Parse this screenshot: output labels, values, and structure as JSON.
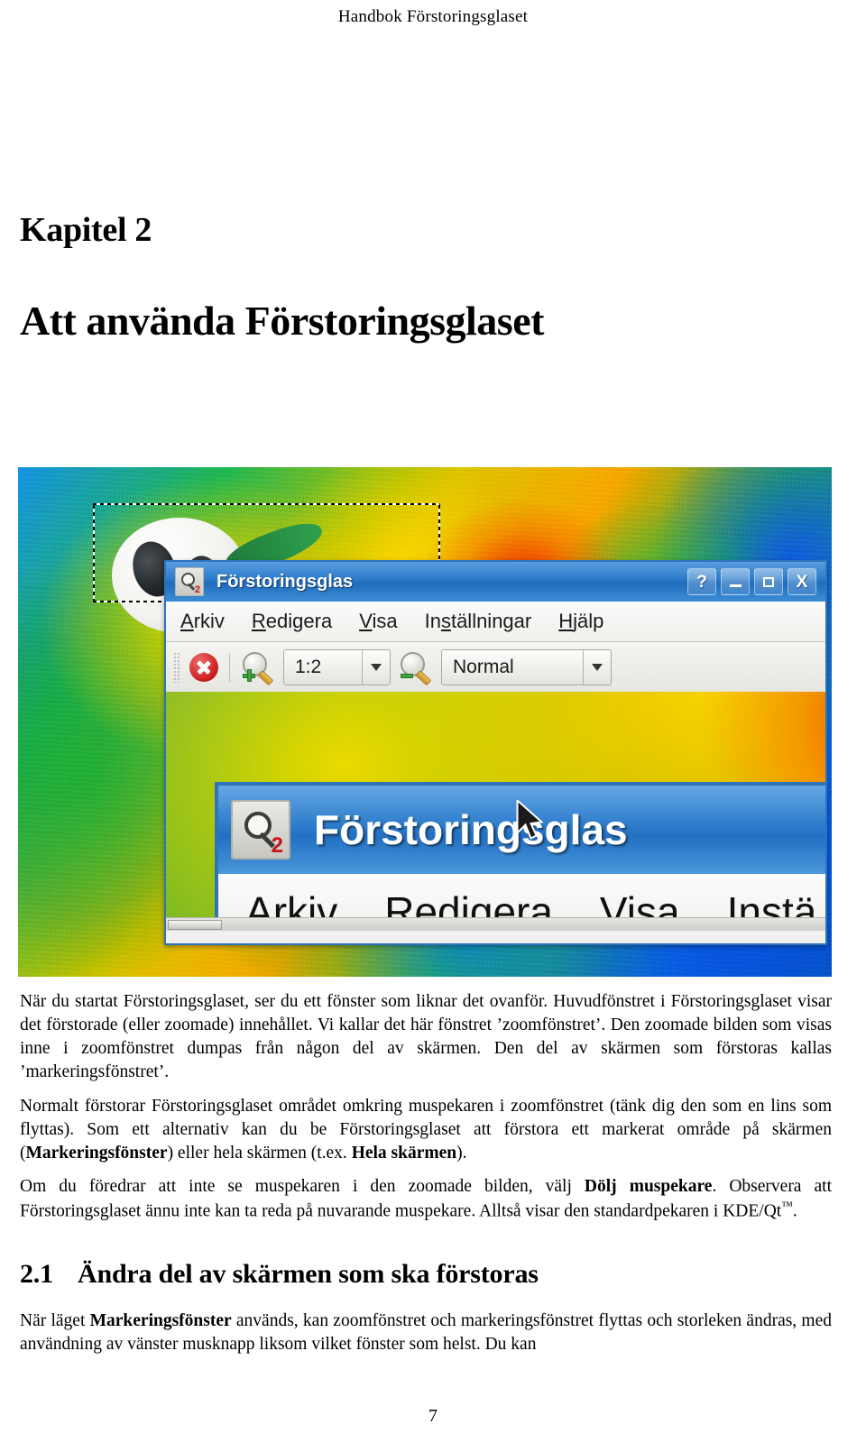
{
  "page": {
    "running_header": "Handbok Förstoringsglaset",
    "page_number": "7"
  },
  "chapter": {
    "number_label": "Kapitel 2",
    "title": "Att använda Förstoringsglaset"
  },
  "figure": {
    "caption": "",
    "window": {
      "title": "Förstoringsglas",
      "icon_name": "magnifier-2-icon",
      "buttons": {
        "help": "?",
        "minimize": "_",
        "maximize": "□",
        "close": "X"
      },
      "menu": [
        {
          "label": "Arkiv",
          "accel": "A"
        },
        {
          "label": "Redigera",
          "accel": "R"
        },
        {
          "label": "Visa",
          "accel": "V"
        },
        {
          "label": "Inställningar",
          "accel": "s"
        },
        {
          "label": "Hjälp",
          "accel": "H"
        }
      ],
      "toolbar": {
        "stop_icon": "stop-refresh-icon",
        "zoom_in_icon": "zoom-in-icon",
        "zoom_out_icon": "zoom-out-icon",
        "zoom_value": "1:2",
        "mode_value": "Normal"
      }
    },
    "zoomed_window": {
      "title": "Förstoringsglas",
      "menu": [
        "Arkiv",
        "Redigera",
        "Visa",
        "Instä"
      ],
      "cursor": "mouse-pointer"
    }
  },
  "body": {
    "paragraphs": [
      {
        "runs": [
          {
            "t": "När du startat Förstoringsglaset, ser du ett fönster som liknar det ovanför. Huvudfönstret i Förstoringsglaset visar det förstorade (eller zoomade) innehållet. Vi kallar det här fönstret ’zoomfönstret’. Den zoomade bilden som visas inne i zoomfönstret dumpas från någon del av skärmen. Den del av skärmen som förstoras kallas ’markeringsfönstret’.",
            "b": false
          }
        ]
      },
      {
        "runs": [
          {
            "t": "Normalt förstorar Förstoringsglaset området omkring muspekaren i zoomfönstret (tänk dig den som en lins som flyttas). Som ett alternativ kan du be Förstoringsglaset att förstora ett markerat område på skärmen (",
            "b": false
          },
          {
            "t": "Markeringsfönster",
            "b": true
          },
          {
            "t": ") eller hela skärmen (t.ex. ",
            "b": false
          },
          {
            "t": "Hela skärmen",
            "b": true
          },
          {
            "t": ").",
            "b": false
          }
        ]
      },
      {
        "runs": [
          {
            "t": "Om du föredrar att inte se muspekaren i den zoomade bilden, välj ",
            "b": false
          },
          {
            "t": "Dölj muspekare",
            "b": true
          },
          {
            "t": ". Observera att Förstoringsglaset ännu inte kan ta reda på nuvarande muspekare. Alltså visar den standardpekaren i KDE/Qt",
            "b": false
          },
          {
            "t": "™",
            "b": false,
            "tm": true
          },
          {
            "t": ".",
            "b": false
          }
        ]
      }
    ]
  },
  "section": {
    "number": "2.1",
    "title": "Ändra del av skärmen som ska förstoras",
    "paragraphs": [
      {
        "runs": [
          {
            "t": "När läget ",
            "b": false
          },
          {
            "t": "Markeringsfönster",
            "b": true
          },
          {
            "t": " används, kan zoomfönstret och markeringsfönstret flyttas och storleken ändras, med användning av vänster musknapp liksom vilket fönster som helst. Du kan",
            "b": false
          }
        ]
      }
    ]
  },
  "colors": {
    "title_bar_blue": "#2d7ccb",
    "window_border": "#2f73bd",
    "toolbar_face": "#eceae5",
    "stop_red": "#c81c1c",
    "plus_green": "#3fa23f"
  }
}
